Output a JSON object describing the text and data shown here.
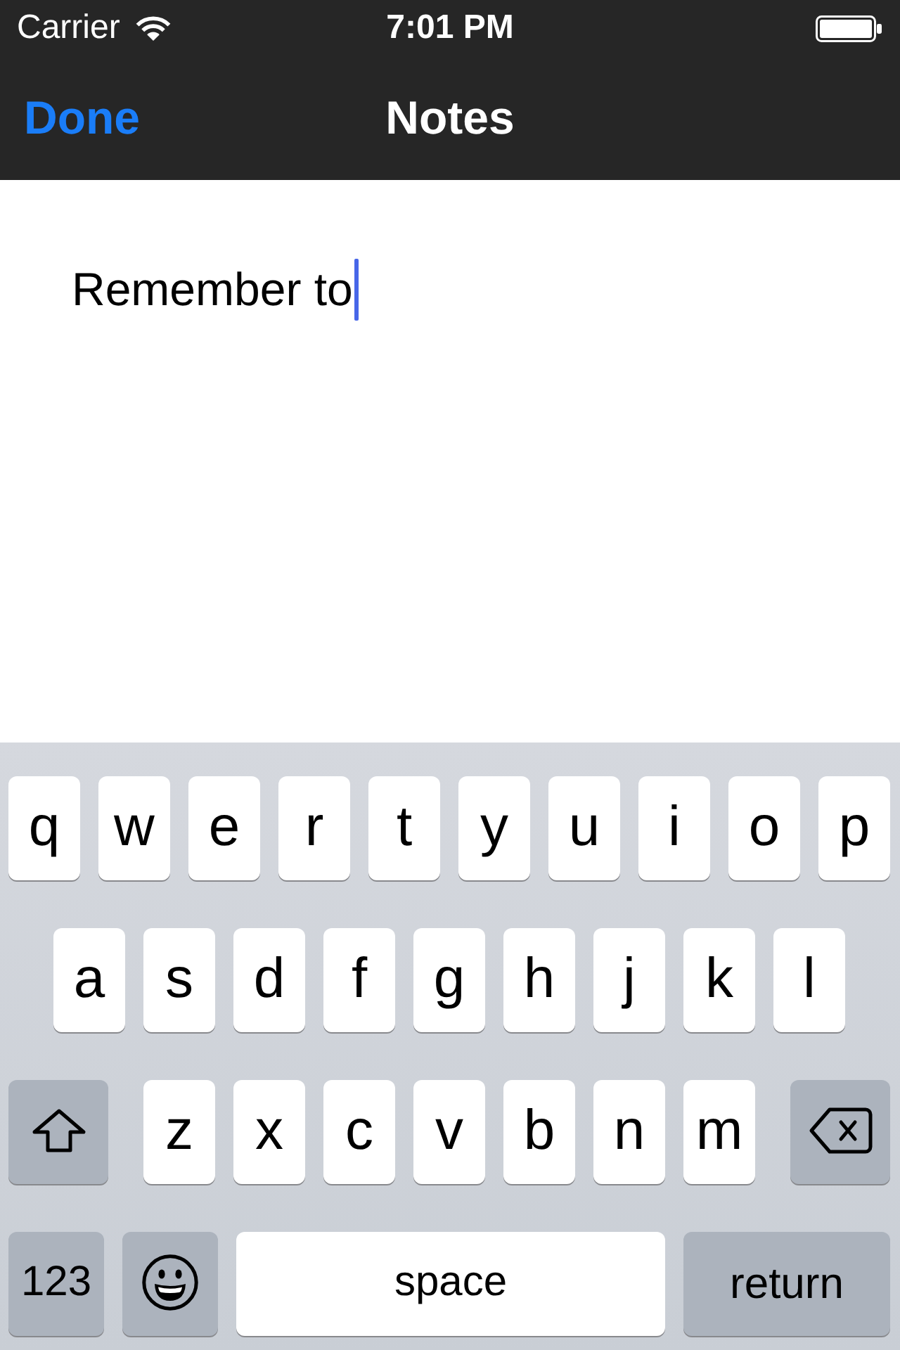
{
  "status_bar": {
    "carrier": "Carrier",
    "time": "7:01 PM"
  },
  "nav_bar": {
    "left_button": "Done",
    "title": "Notes"
  },
  "note": {
    "value": "Remember to"
  },
  "keyboard": {
    "rows": [
      {
        "keys": [
          {
            "kind": "letter",
            "label": "q"
          },
          {
            "kind": "letter",
            "label": "w"
          },
          {
            "kind": "letter",
            "label": "e"
          },
          {
            "kind": "letter",
            "label": "r"
          },
          {
            "kind": "letter",
            "label": "t"
          },
          {
            "kind": "letter",
            "label": "y"
          },
          {
            "kind": "letter",
            "label": "u"
          },
          {
            "kind": "letter",
            "label": "i"
          },
          {
            "kind": "letter",
            "label": "o"
          },
          {
            "kind": "letter",
            "label": "p"
          }
        ]
      },
      {
        "keys": [
          {
            "kind": "letter",
            "label": "a"
          },
          {
            "kind": "letter",
            "label": "s"
          },
          {
            "kind": "letter",
            "label": "d"
          },
          {
            "kind": "letter",
            "label": "f"
          },
          {
            "kind": "letter",
            "label": "g"
          },
          {
            "kind": "letter",
            "label": "h"
          },
          {
            "kind": "letter",
            "label": "j"
          },
          {
            "kind": "letter",
            "label": "k"
          },
          {
            "kind": "letter",
            "label": "l"
          }
        ]
      },
      {
        "keys": [
          {
            "kind": "shift"
          },
          {
            "kind": "letter",
            "label": "z"
          },
          {
            "kind": "letter",
            "label": "x"
          },
          {
            "kind": "letter",
            "label": "c"
          },
          {
            "kind": "letter",
            "label": "v"
          },
          {
            "kind": "letter",
            "label": "b"
          },
          {
            "kind": "letter",
            "label": "n"
          },
          {
            "kind": "letter",
            "label": "m"
          },
          {
            "kind": "delete"
          }
        ]
      },
      {
        "keys": [
          {
            "kind": "numbers",
            "label": "123"
          },
          {
            "kind": "emoji"
          },
          {
            "kind": "space",
            "label": "space"
          },
          {
            "kind": "return",
            "label": "return"
          }
        ]
      }
    ]
  }
}
